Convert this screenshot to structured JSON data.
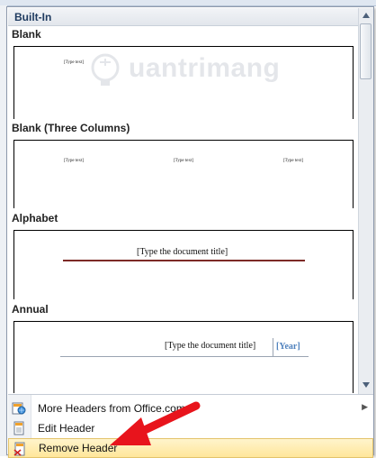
{
  "gallery": {
    "section_header": "Built-In",
    "items": [
      {
        "label": "Blank",
        "placeholders": [
          "[Type text]"
        ]
      },
      {
        "label": "Blank (Three Columns)",
        "placeholders": [
          "[Type text]",
          "[Type text]",
          "[Type text]"
        ]
      },
      {
        "label": "Alphabet",
        "title_placeholder": "[Type the document title]"
      },
      {
        "label": "Annual",
        "title_placeholder": "[Type the document title]",
        "year_placeholder": "[Year]"
      }
    ]
  },
  "menu": {
    "items": [
      {
        "label": "More Headers from Office.com",
        "icon": "office-globe-icon",
        "has_submenu": true
      },
      {
        "label": "Edit Header",
        "icon": "edit-header-icon"
      },
      {
        "label": "Remove Header",
        "icon": "remove-header-icon",
        "highlighted": true
      }
    ]
  },
  "watermark": {
    "text": "uantrimang"
  },
  "colors": {
    "accent_year": "#4f81bd",
    "alphabet_rule": "#7d2a26",
    "hover_bg": "#ffe69a",
    "annotation_arrow": "#e8141c"
  }
}
